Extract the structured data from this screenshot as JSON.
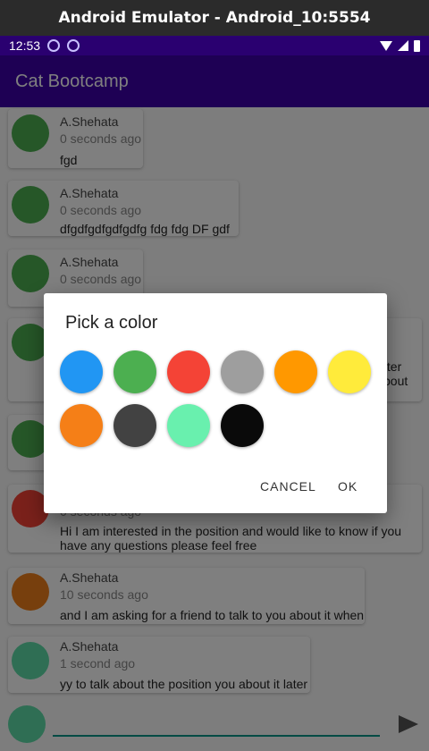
{
  "window": {
    "title": "Android Emulator - Android_10:5554"
  },
  "status_bar": {
    "time": "12:53",
    "icons": [
      "settings-notification-icon",
      "sync-notification-icon",
      "wifi-icon",
      "signal-icon",
      "battery-icon"
    ]
  },
  "app": {
    "title": "Cat Bootcamp",
    "accent": "#3c00a8"
  },
  "messages": [
    {
      "author": "A.Shehata",
      "time": "0 seconds ago",
      "text": "fgd",
      "avatar_color": "#4caf50"
    },
    {
      "author": "A.Shehata",
      "time": "0 seconds ago",
      "text": "dfgdfgdfgdfgdfg fdg fdg DF gdf",
      "avatar_color": "#4caf50"
    },
    {
      "author": "A.Shehata",
      "time": "0 seconds ago",
      "text": "",
      "avatar_color": "#4caf50"
    },
    {
      "author": "",
      "time": "",
      "text_line1": "tter",
      "text_line2": "bout",
      "avatar_color": "#4caf50"
    },
    {
      "author": "",
      "time": "",
      "text": "",
      "avatar_color": "#4caf50"
    },
    {
      "author": "",
      "time": "0 seconds ago",
      "text_line1": "Hi I am interested in the position and would like to know if you",
      "text_line2": "have any questions please feel free",
      "avatar_color": "#f44336"
    },
    {
      "author": "A.Shehata",
      "time": "10 seconds ago",
      "text": "and I am asking for a friend to talk to you about it when",
      "avatar_color": "#ef7f1a"
    },
    {
      "author": "A.Shehata",
      "time": "1 second ago",
      "text": "yy to talk about the position you about it later",
      "avatar_color": "#5fdca8"
    }
  ],
  "composer": {
    "avatar_color": "#5fdca8",
    "input_value": ""
  },
  "dialog": {
    "title": "Pick a color",
    "colors": [
      "#2196f3",
      "#4caf50",
      "#f44336",
      "#9e9e9e",
      "#ff9800",
      "#ffeb3b",
      "#f57f17",
      "#424242",
      "#69f0ae",
      "#0a0a0a"
    ],
    "cancel_label": "CANCEL",
    "ok_label": "OK"
  }
}
